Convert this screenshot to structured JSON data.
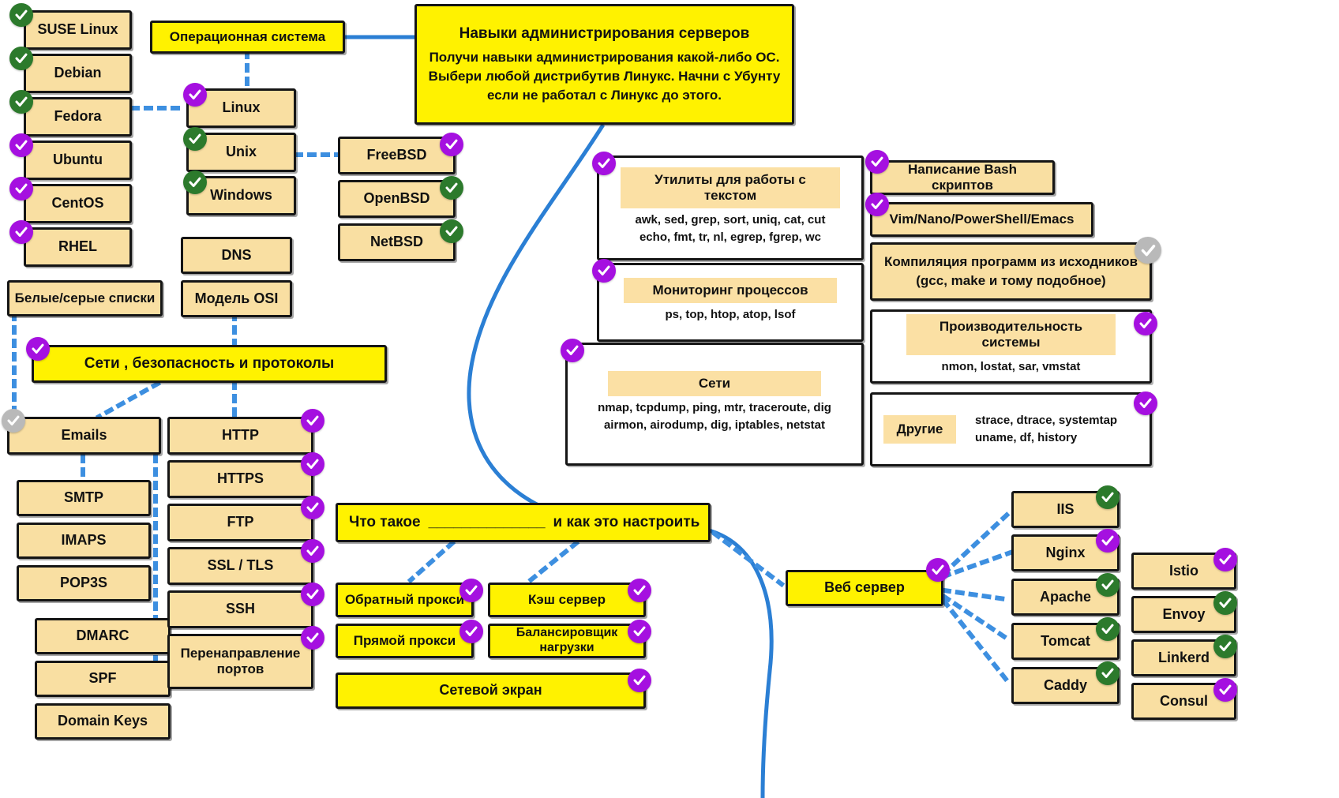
{
  "title_card": {
    "heading": "Навыки администрирования серверов",
    "lines": [
      "Получи навыки администрирования какой-либо ОС.",
      "Выбери любой дистрибутив Линукс. Начни с Убунту",
      "если не работал с Линукс до этого."
    ]
  },
  "colors": {
    "yellow": "#fff200",
    "beige": "#f9dfa2",
    "check_done": "#a510e0",
    "check_alt": "#2c7a2c",
    "check_none": "#b9b9b9",
    "link_blue": "#2b7fd4",
    "outline": "#151515"
  },
  "nodes": {
    "os_root": "Операционная система",
    "distros": [
      "SUSE Linux",
      "Debian",
      "Fedora",
      "Ubuntu",
      "CentOS",
      "RHEL"
    ],
    "os_kinds": [
      "Linux",
      "Unix",
      "Windows"
    ],
    "bsds": [
      "FreeBSD",
      "OpenBSD",
      "NetBSD"
    ],
    "net_basics": [
      "DNS",
      "Модель OSI"
    ],
    "greylists": "Белые/серые списки",
    "net_root": "Сети , безопасность и протоколы",
    "emails": "Emails",
    "email_children": [
      "SMTP",
      "IMAPS",
      "POP3S"
    ],
    "email_auth": [
      "DMARC",
      "SPF",
      "Domain Keys"
    ],
    "protocols": [
      "HTTP",
      "HTTPS",
      "FTP",
      "SSL / TLS",
      "SSH"
    ],
    "port_forward": [
      "Перенаправление",
      "портов"
    ],
    "what_is": {
      "pre": "Что такое",
      "blank": "______________",
      "post": "и как это настроить"
    },
    "proxies": [
      "Обратный прокси",
      "Прямой прокси"
    ],
    "servers": [
      "Кэш сервер",
      "Балансировщик нагрузки"
    ],
    "firewall": "Сетевой экран",
    "web_server": "Веб сервер",
    "web_servers": [
      "IIS",
      "Nginx",
      "Apache",
      "Tomcat",
      "Caddy"
    ],
    "meshes": [
      "Istio",
      "Envoy",
      "Linkerd",
      "Consul"
    ]
  },
  "cards": {
    "text_utils": {
      "header": "Утилиты для работы с текстом",
      "lines": [
        "awk, sed, grep, sort, uniq, cat, cut",
        "echo, fmt, tr, nl, egrep, fgrep, wc"
      ]
    },
    "proc_monitor": {
      "header": "Мониторинг процессов",
      "lines": [
        "ps, top, htop, atop, lsof"
      ]
    },
    "networks": {
      "header": "Сети",
      "lines": [
        "nmap, tcpdump, ping, mtr, traceroute, dig",
        "airmon, airodump, dig, iptables, netstat"
      ]
    },
    "bash": {
      "header": "Написание Bash скриптов"
    },
    "editors": {
      "header": "Vim/Nano/PowerShell/Emacs"
    },
    "compile": {
      "lines": [
        "Компиляция программ из исходников",
        "(gcc, make и тому подобное)"
      ]
    },
    "performance": {
      "header": "Производительность системы",
      "lines": [
        "nmon, lostat, sar, vmstat"
      ]
    },
    "other": {
      "header": "Другие",
      "lines": [
        "strace, dtrace, systemtap",
        "uname, df, history"
      ]
    }
  }
}
